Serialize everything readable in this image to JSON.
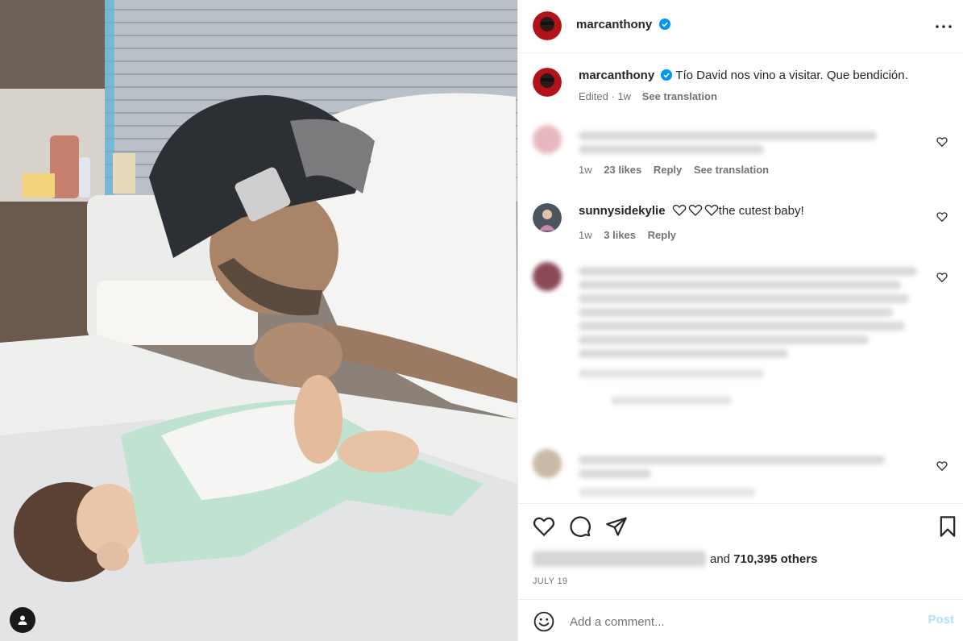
{
  "post": {
    "username": "marcanthony",
    "caption": "Tío David nos vino a visitar. Que bendición.",
    "caption_status": "Edited",
    "caption_age": "1w",
    "see_translation": "See translation"
  },
  "comments": [
    {
      "age": "1w",
      "likes": "23 likes",
      "reply": "Reply",
      "translate": "See translation"
    },
    {
      "username": "sunnysidekylie",
      "text": "the cutest baby!",
      "age": "1w",
      "likes": "3 likes",
      "reply": "Reply"
    }
  ],
  "likes": {
    "and": "and",
    "count": "710,395 others"
  },
  "date": "JULY 19",
  "composer": {
    "placeholder": "Add a comment...",
    "post_label": "Post"
  },
  "colors": {
    "verified": "#0095f6",
    "link_blue": "#b2dffc",
    "secondary_text": "#737373"
  },
  "icons": [
    "more-options-icon",
    "verified-badge-icon",
    "heart-icon",
    "comment-icon",
    "share-icon",
    "bookmark-icon",
    "emoji-icon",
    "user-tag-icon"
  ]
}
